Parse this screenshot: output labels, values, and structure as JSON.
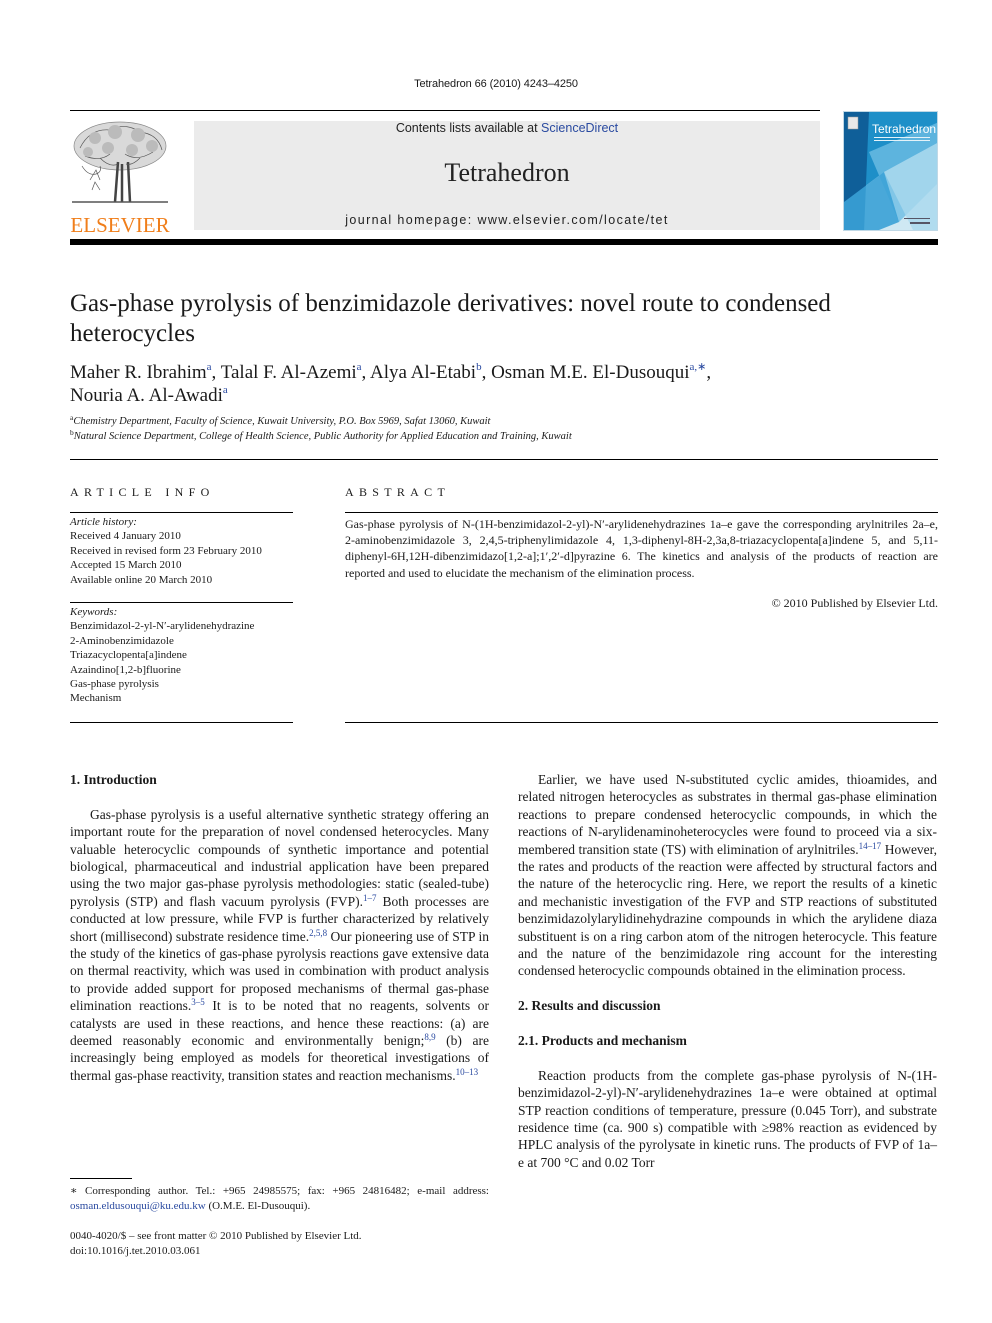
{
  "header": {
    "journal_ref": "Tetrahedron 66 (2010) 4243–4250",
    "contents_prefix": "Contents lists available at ",
    "contents_link": "ScienceDirect",
    "journal_name": "Tetrahedron",
    "homepage": "journal homepage: www.elsevier.com/locate/tet",
    "publisher_logo_text": "ELSEVIER",
    "cover_title": "Tetrahedron",
    "colors": {
      "elsevier_orange": "#f07e1a",
      "link_blue": "#2a4aa0",
      "banner_gray": "#ebebeb",
      "cover_blue": "#1e8fc8"
    }
  },
  "article": {
    "title": "Gas-phase pyrolysis of benzimidazole derivatives: novel route to condensed heterocycles",
    "authors": [
      {
        "name": "Maher R. Ibrahim",
        "sup": "a",
        "sep": ", "
      },
      {
        "name": "Talal F. Al-Azemi",
        "sup": "a",
        "sep": ", "
      },
      {
        "name": "Alya Al-Etabi",
        "sup": "b",
        "sep": ", "
      },
      {
        "name": "Osman M.E. El-Dusouqui",
        "sup": "a,∗",
        "sep": ", "
      },
      {
        "name": "Nouria A. Al-Awadi",
        "sup": "a",
        "sep": ""
      }
    ],
    "affiliations": [
      {
        "key": "a",
        "text": "Chemistry Department, Faculty of Science, Kuwait University, P.O. Box 5969, Safat 13060, Kuwait"
      },
      {
        "key": "b",
        "text": "Natural Science Department, College of Health Science, Public Authority for Applied Education and Training, Kuwait"
      }
    ]
  },
  "article_info": {
    "heading": "ARTICLE INFO",
    "history_label": "Article history:",
    "history": [
      "Received 4 January 2010",
      "Received in revised form 23 February 2010",
      "Accepted 15 March 2010",
      "Available online 20 March 2010"
    ],
    "keywords_label": "Keywords:",
    "keywords": [
      "Benzimidazol-2-yl-N′-arylidenehydrazine",
      "2-Aminobenzimidazole",
      "Triazacyclopenta[a]indene",
      "Azaindino[1,2-b]fluorine",
      "Gas-phase pyrolysis",
      "Mechanism"
    ]
  },
  "abstract": {
    "heading": "ABSTRACT",
    "text": "Gas-phase pyrolysis of N-(1H-benzimidazol-2-yl)-N′-arylidenehydrazines 1a–e gave the corresponding arylnitriles 2a–e, 2-aminobenzimidazole 3, 2,4,5-triphenylimidazole 4, 1,3-diphenyl-8H-2,3a,8-triazacyclopenta[a]indene 5, and 5,11-diphenyl-6H,12H-dibenzimidazo[1,2-a];1′,2′-d]pyrazine 6. The kinetics and analysis of the products of reaction are reported and used to elucidate the mechanism of the elimination process.",
    "copyright": "© 2010 Published by Elsevier Ltd."
  },
  "body": {
    "intro_heading": "1.  Introduction",
    "intro_p1": [
      {
        "t": "Gas-phase pyrolysis is a useful alternative synthetic strategy offering an important route for the preparation of novel condensed heterocycles. Many valuable heterocyclic compounds of synthetic importance and potential biological, pharmaceutical and industrial application have been prepared using the two major gas-phase pyrolysis methodologies: static (sealed-tube) pyrolysis (STP) and flash vacuum pyrolysis (FVP)."
      },
      {
        "ref": "1–7"
      },
      {
        "t": " Both processes are conducted at low pressure, while FVP is further characterized by relatively short (millisecond) substrate residence time."
      },
      {
        "ref": "2,5,8"
      },
      {
        "t": " Our pioneering use of STP in the study of the kinetics of gas-phase pyrolysis reactions gave extensive data on thermal reactivity, which was used in combination with product analysis to provide added support for proposed mechanisms of thermal gas-phase elimination reactions."
      },
      {
        "ref": "3–5"
      },
      {
        "t": " It is to be noted that no reagents, solvents or catalysts are used in these reactions, and hence these reactions: (a) are deemed reasonably economic and environmentally benign;"
      },
      {
        "ref": "8,9"
      },
      {
        "t": " (b) are increasingly being employed as models for theoretical investigations of thermal gas-phase reactivity, transition states and reaction mechanisms."
      },
      {
        "ref": "10–13"
      }
    ],
    "intro_p2": [
      {
        "t": "Earlier, we have used N-substituted cyclic amides, thioamides, and related nitrogen heterocycles as substrates in thermal gas-phase elimination reactions to prepare condensed heterocyclic compounds, in which the reactions of N-arylidenaminoheterocycles were found to proceed via a six-membered transition state (TS) with elimination of arylnitriles."
      },
      {
        "ref": "14–17"
      },
      {
        "t": " However, the rates and products of the reaction were affected by structural factors and the nature of the heterocyclic ring. Here, we report the results of a kinetic and mechanistic investigation of the FVP and STP reactions of substituted benzimidazolylarylidinehydrazine compounds in which the arylidene diaza substituent is on a ring carbon atom of the nitrogen heterocycle. This feature and the nature of the benzimidazole ring account for the interesting condensed heterocyclic compounds obtained in the elimination process."
      }
    ],
    "results_heading": "2.  Results and discussion",
    "products_heading": "2.1.  Products and mechanism",
    "results_p1": "Reaction products from the complete gas-phase pyrolysis of N-(1H-benzimidazol-2-yl)-N′-arylidenehydrazines 1a–e were obtained at optimal STP reaction conditions of temperature, pressure (0.045 Torr), and substrate residence time (ca. 900 s) compatible with ≥98% reaction as evidenced by HPLC analysis of the pyrolysate in kinetic runs. The products of FVP of 1a–e at 700 °C and 0.02 Torr"
  },
  "footnotes": {
    "corresponding_prefix": "∗ Corresponding author. Tel.: +965 24985575; fax: +965 24816482; e-mail address: ",
    "email": "osman.eldusouqui@ku.edu.kw",
    "corresponding_suffix": " (O.M.E. El-Dusouqui).",
    "issn_line": "0040-4020/$ – see front matter © 2010 Published by Elsevier Ltd.",
    "doi": "doi:10.1016/j.tet.2010.03.061"
  }
}
